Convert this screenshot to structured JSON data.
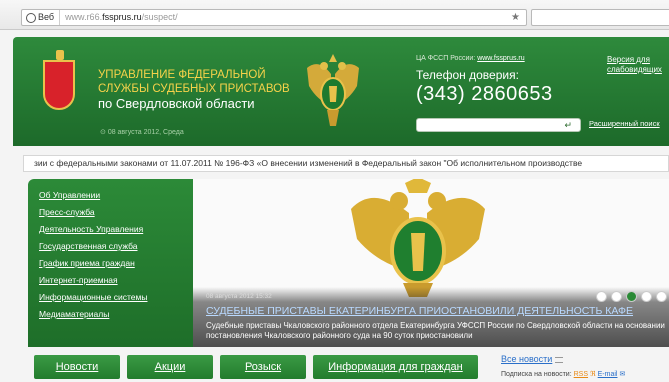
{
  "browser": {
    "mode_label": "Веб",
    "url_prefix": "www.r66.",
    "url_host": "fssprus.ru",
    "url_path": "/suspect/"
  },
  "header": {
    "org_line1": "УПРАВЛЕНИЕ ФЕДЕРАЛЬНОЙ",
    "org_line2": "СЛУЖБЫ СУДЕБНЫХ ПРИСТАВОВ",
    "org_line3": "по Свердловской области",
    "date": "08 августа 2012, Среда",
    "central_label": "ЦА ФССП России:",
    "central_link": "www.fssprus.ru",
    "hotline_label": "Телефон доверия:",
    "hotline_phone": "(343) 2860653",
    "version_link_1": "Версия для",
    "version_link_2": "слабовидящих",
    "advanced_search": "Расширенный поиск",
    "search_value": ""
  },
  "ticker": {
    "text": "зии с федеральными законами от 11.07.2011 № 196-ФЗ «О внесении изменений в Федеральный закон \"Об исполнительном производстве"
  },
  "sidebar": {
    "items": [
      {
        "label": "Об Управлении"
      },
      {
        "label": "Пресс-служба"
      },
      {
        "label": "Деятельность Управления"
      },
      {
        "label": "Государственная служба"
      },
      {
        "label": "График приема граждан"
      },
      {
        "label": "Интернет-приемная"
      },
      {
        "label": "Информационные системы"
      },
      {
        "label": "Медиаматериалы"
      }
    ]
  },
  "banner": {
    "date": "08 августа 2012  15:32",
    "title": "СУДЕБНЫЕ ПРИСТАВЫ ЕКАТЕРИНБУРГА ПРИОСТАНОВИЛИ ДЕЯТЕЛЬНОСТЬ КАФЕ",
    "text": "Судебные приставы Чкаловского районного отдела Екатеринбурга УФССП России по Свердловской области на основании постановления Чкаловского районного суда на 90 суток приостановили",
    "slides": 5,
    "active_slide": 3
  },
  "tabs": [
    {
      "label": "Новости"
    },
    {
      "label": "Акции"
    },
    {
      "label": "Розыск"
    },
    {
      "label": "Информация для граждан"
    }
  ],
  "news": {
    "all_news": "Все новости",
    "subscribe_label": "Подписка на новости:",
    "rss": "RSS",
    "email": "E-mail"
  },
  "colors": {
    "header_green": "#2e8a3c",
    "accent_gold": "#f6d24a",
    "link_blue": "#2a6fc9"
  }
}
